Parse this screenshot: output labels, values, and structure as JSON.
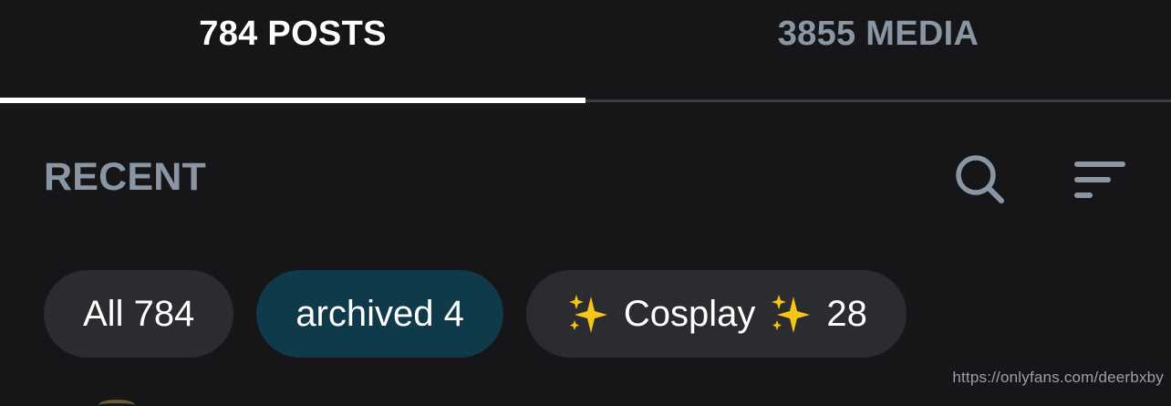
{
  "tabs": [
    {
      "label": "784 POSTS",
      "active": true
    },
    {
      "label": "3855 MEDIA",
      "active": false
    }
  ],
  "section": {
    "title": "RECENT"
  },
  "icons": {
    "search": "search-icon",
    "sort": "sort-icon",
    "sparkle": "sparkles-icon"
  },
  "chips": {
    "all": "All 784",
    "archived": "archived 4",
    "cosplay_label": "Cosplay",
    "cosplay_count": "28"
  },
  "watermark": "https://onlyfans.com/deerbxby",
  "colors": {
    "background": "#161618",
    "muted_text": "#8a96a3",
    "chip_bg": "#2a2c2f",
    "chip_selected_bg": "#0f3a4a",
    "sparkle": "#f5c518"
  }
}
